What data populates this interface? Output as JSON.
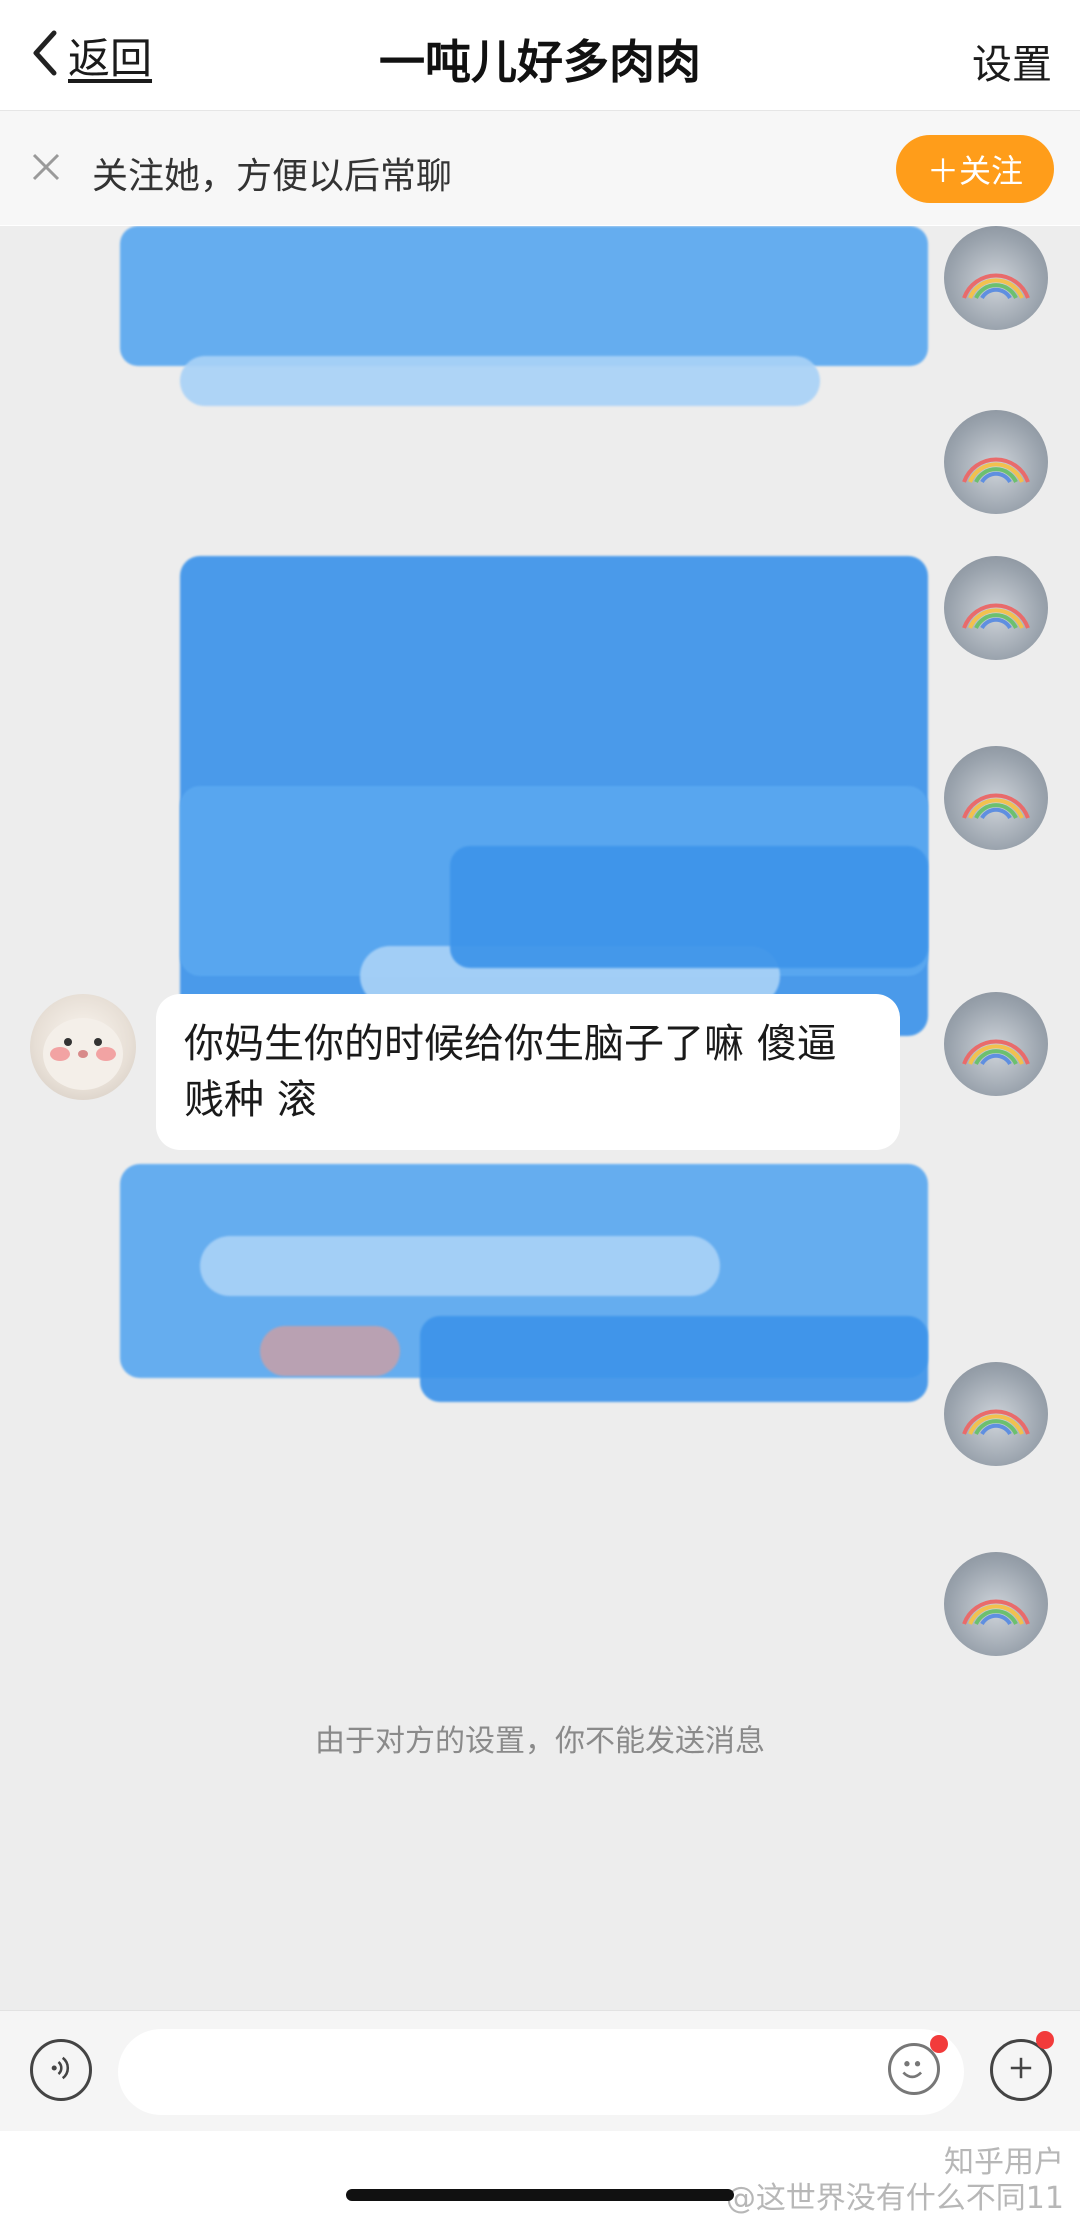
{
  "nav": {
    "back_label": "返回",
    "title": "一吨儿好多肉肉",
    "settings_label": "设置"
  },
  "follow_banner": {
    "text": "关注她，方便以后常聊",
    "follow_button_label": "＋关注"
  },
  "messages": {
    "received_text": "你妈生你的时候给你生脑子了嘛 傻逼 贱种 滚"
  },
  "system_note": "由于对方的设置，你不能发送消息",
  "input": {
    "value": "",
    "placeholder": ""
  },
  "watermark": {
    "brand": "知乎用户",
    "handle": "@这世界没有什么不同11"
  },
  "colors": {
    "accent_orange": "#ff9d1a",
    "redaction_blue": "#5aa8f0",
    "chat_background": "#ededed",
    "badge_red": "#f23b3b"
  },
  "icons": {
    "back": "chevron-left-icon",
    "close": "close-icon",
    "voice": "voice-icon",
    "emoji": "emoji-icon",
    "plus": "plus-icon"
  }
}
